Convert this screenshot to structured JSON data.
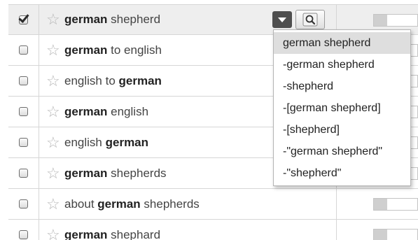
{
  "keyword_rows": [
    {
      "checked": true,
      "bold": "german",
      "rest": " shepherd",
      "pre": "",
      "volume_fraction": 0.3
    },
    {
      "checked": false,
      "bold": "german",
      "rest": " to english",
      "pre": "",
      "volume_fraction": 0.3
    },
    {
      "checked": false,
      "bold": "german",
      "rest": "",
      "pre": "english to ",
      "volume_fraction": 0.3
    },
    {
      "checked": false,
      "bold": "german",
      "rest": " english",
      "pre": "",
      "volume_fraction": 0.3
    },
    {
      "checked": false,
      "bold": "german",
      "rest": "",
      "pre": "english ",
      "volume_fraction": 0.3
    },
    {
      "checked": false,
      "bold": "german",
      "rest": " shepherds",
      "pre": "",
      "volume_fraction": 0.3
    },
    {
      "checked": false,
      "bold": "german",
      "rest": " shepherds",
      "pre": "about ",
      "volume_fraction": 0.3
    },
    {
      "checked": false,
      "bold": "german",
      "rest": " shephard",
      "pre": "",
      "volume_fraction": 0.3
    }
  ],
  "match_type_dropdown": {
    "open": true,
    "selected_index": 0,
    "options": [
      "german shepherd",
      "-german shepherd",
      "-shepherd",
      "-[german shepherd]",
      "-[shepherd]",
      "-\"german shepherd\"",
      "-\"shepherd\""
    ]
  },
  "icons": {
    "row_checkbox": "checkbox",
    "row_star": "star-icon",
    "match_type_toggle": "chevron-down-icon",
    "search_button": "magnifier-icon"
  }
}
